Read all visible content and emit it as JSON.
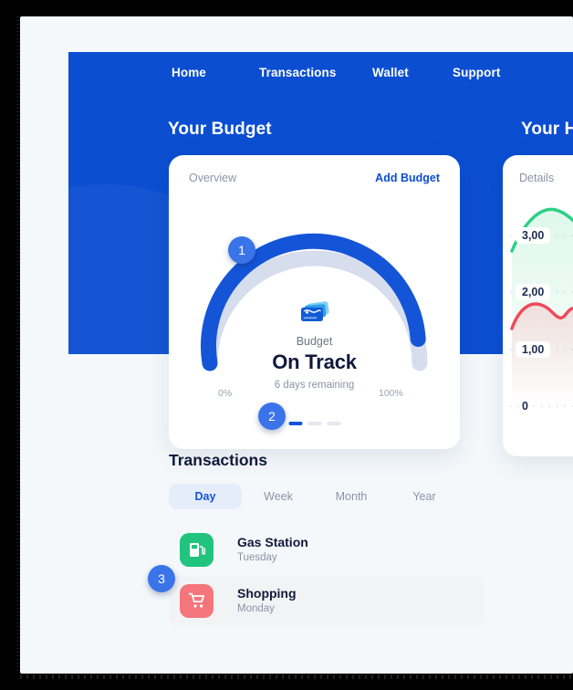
{
  "nav": {
    "items": [
      {
        "label": "Home"
      },
      {
        "label": "Transactions"
      },
      {
        "label": "Wallet"
      },
      {
        "label": "Support"
      }
    ]
  },
  "sections": {
    "budget_title": "Your Budget",
    "history_title": "Your Hist"
  },
  "budget_card": {
    "head_label": "Overview",
    "head_action": "Add Budget",
    "icon": "cards-stack-icon",
    "sub_label": "Budget",
    "status": "On Track",
    "note": "6 days remaining",
    "tick_min": "0%",
    "tick_max": "100%",
    "gauge_percent": 88,
    "gauge_fill_color": "#1455d8",
    "gauge_track_color": "#d6dded",
    "dots": [
      {
        "active": true
      },
      {
        "active": false
      },
      {
        "active": false
      }
    ]
  },
  "history_card": {
    "head_label": "Details",
    "y_labels": [
      "3,00",
      "2,00",
      "1,00",
      "0"
    ]
  },
  "chart_data": {
    "type": "line",
    "title": "Your History",
    "xlabel": "",
    "ylabel": "",
    "ylim": [
      0,
      3500
    ],
    "ytick_labels": [
      "0",
      "1,00",
      "2,00",
      "3,00"
    ],
    "ytick_values": [
      0,
      1000,
      2000,
      3000
    ],
    "grid": true,
    "legend": "none",
    "series": [
      {
        "name": "green-series",
        "color": "#2ecf86",
        "values": [
          2800,
          3180,
          3320,
          3250,
          3080,
          3020,
          3050
        ]
      },
      {
        "name": "red-series",
        "color": "#ef4a5a",
        "values": [
          1820,
          1680,
          1760,
          1560,
          1080,
          1040,
          1120
        ]
      }
    ]
  },
  "transactions": {
    "title": "Transactions",
    "tabs": [
      {
        "label": "Day",
        "active": true
      },
      {
        "label": "Week",
        "active": false
      },
      {
        "label": "Month",
        "active": false
      },
      {
        "label": "Year",
        "active": false
      }
    ],
    "rows": [
      {
        "name": "Gas Station",
        "day": "Tuesday",
        "icon": "gas-pump-icon",
        "icon_color": "#21c47e",
        "highlight": false
      },
      {
        "name": "Shopping",
        "day": "Monday",
        "icon": "shopping-cart-icon",
        "icon_color": "#f4767c",
        "highlight": true
      }
    ]
  },
  "callouts": [
    {
      "label": "1"
    },
    {
      "label": "2"
    },
    {
      "label": "3"
    }
  ],
  "colors": {
    "brand_blue": "#0B4ED1",
    "accent_blue": "#1455d8",
    "badge_blue": "#3A74E8",
    "page_bg": "#f4f8fb",
    "text_dark": "#111a3c",
    "text_muted": "#8a94a6"
  }
}
